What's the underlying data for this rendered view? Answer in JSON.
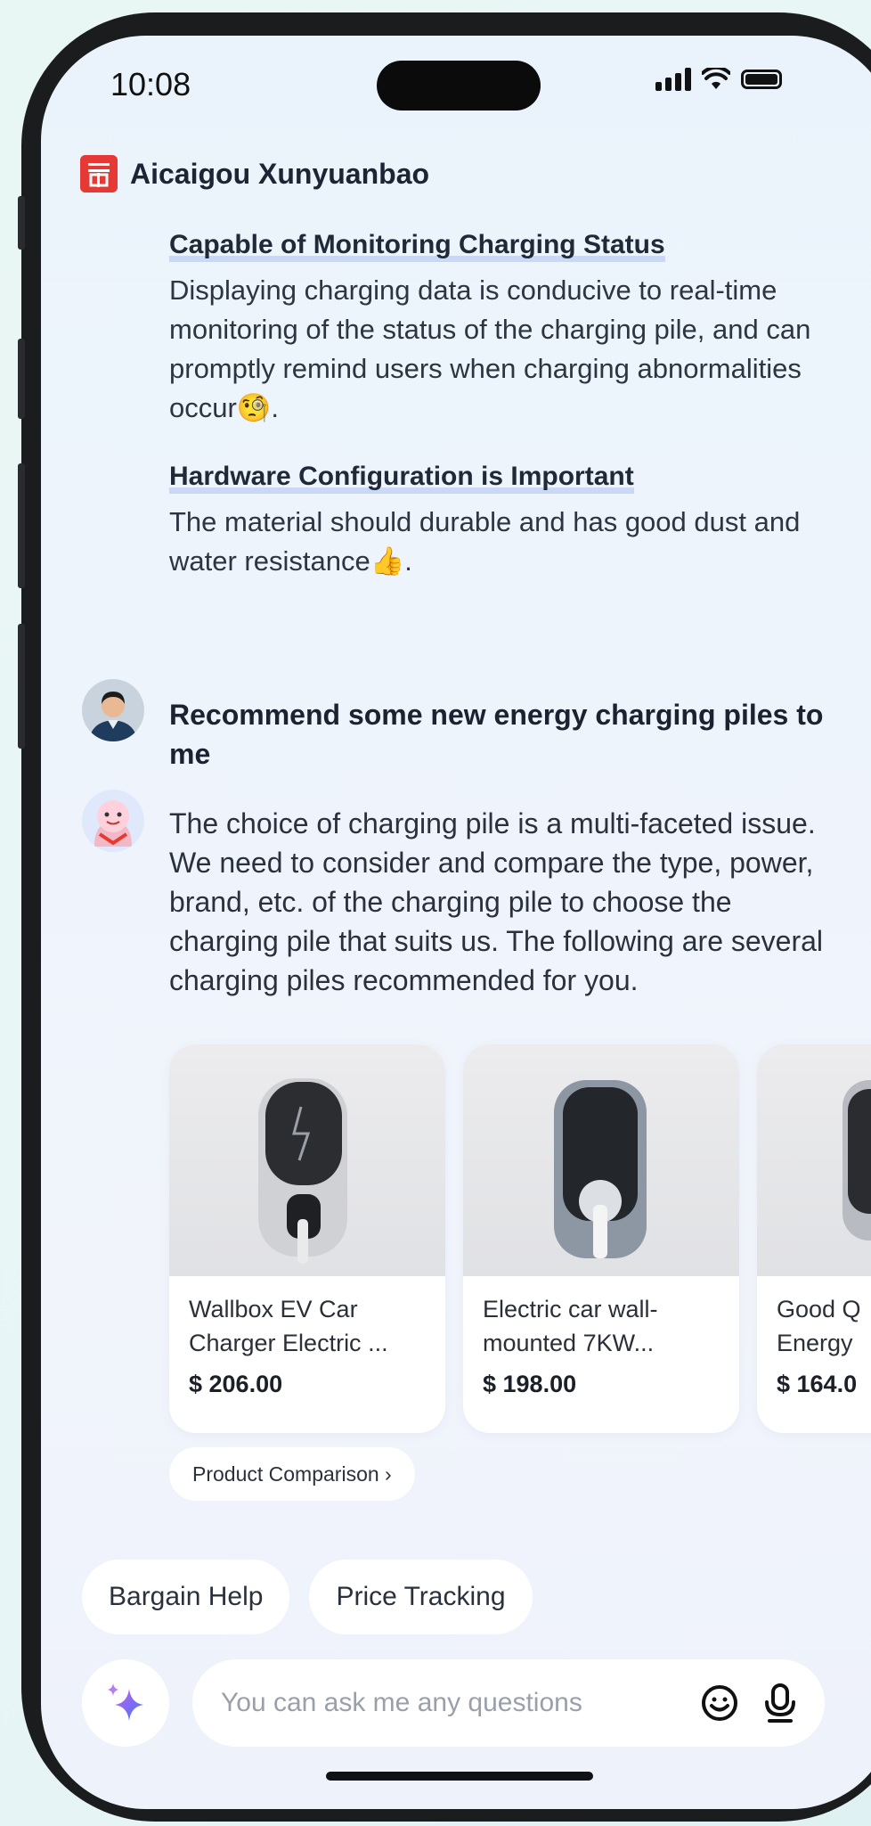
{
  "status": {
    "time": "10:08"
  },
  "brand": {
    "name": "Aicaigou Xunyuanbao"
  },
  "sections": [
    {
      "heading": "Capable of Monitoring Charging Status",
      "body": "Displaying charging data is conducive to real-time monitoring of the status of the charging pile, and can promptly remind users when charging abnormalities occur🧐."
    },
    {
      "heading": "Hardware Configuration is Important",
      "body": "The material should durable and has good dust and water resistance👍."
    }
  ],
  "user_message": "Recommend some new energy charging piles to me",
  "bot_answer": "The choice of charging pile is a multi-faceted issue. We need to consider and compare the type, power, brand, etc. of the charging pile to choose the charging pile that suits us. The following are several charging piles recommended for you.",
  "products": [
    {
      "title_line1": "Wallbox EV Car",
      "title_line2": "Charger Electric ...",
      "price": "$ 206.00"
    },
    {
      "title_line1": "Electric car wall-",
      "title_line2": "mounted 7KW...",
      "price": "$ 198.00"
    },
    {
      "title_line1": "Good Q",
      "title_line2": "Energy",
      "price": "$ 164.0"
    }
  ],
  "compare_label": "Product Comparison ›",
  "chips": [
    "Bargain Help",
    "Price Tracking"
  ],
  "input": {
    "placeholder": "You can ask me any questions"
  },
  "icons": {
    "brand": "brand-logo-icon",
    "spark": "sparkle-icon",
    "emoji": "smiley-icon",
    "mic": "microphone-icon"
  }
}
